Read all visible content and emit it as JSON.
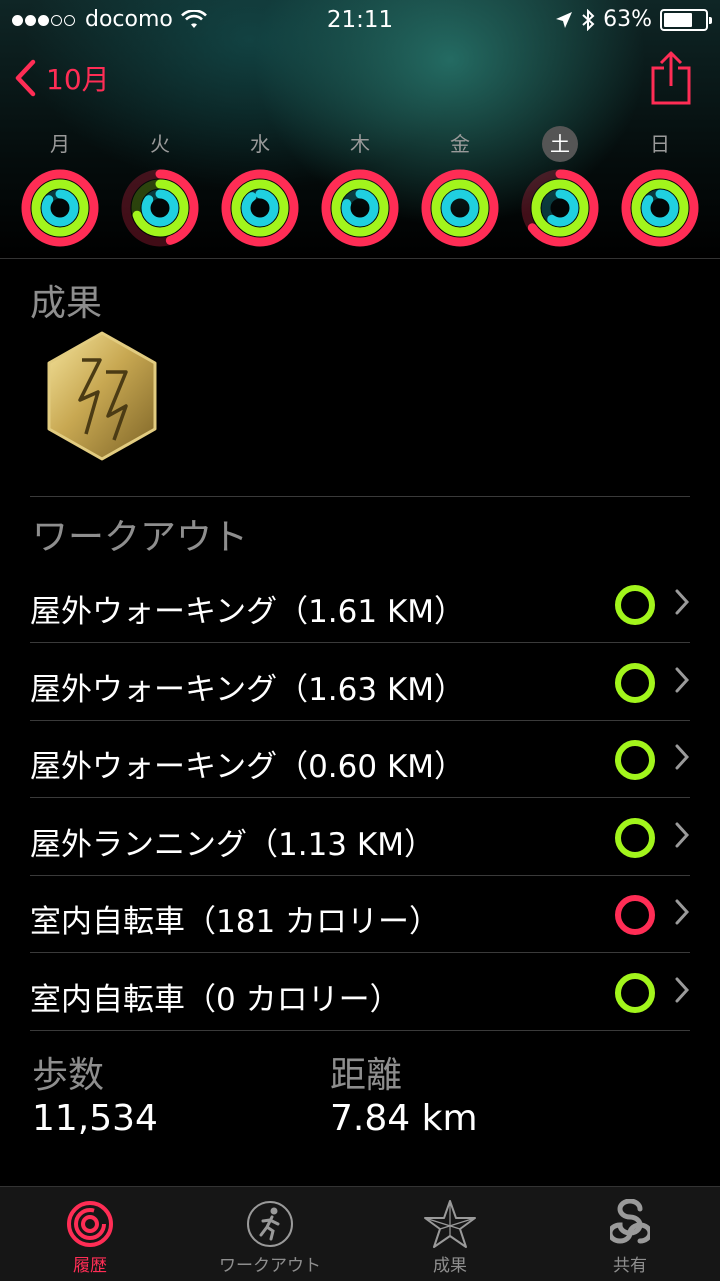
{
  "status": {
    "carrier": "docomo",
    "time": "21:11",
    "battery": "63%",
    "signal_bars_filled": 3,
    "signal_bars_total": 5
  },
  "nav": {
    "back_label": "10月"
  },
  "week": [
    {
      "label": "月",
      "selected": false,
      "move": 1.0,
      "exercise": 1.0,
      "stand": 0.85
    },
    {
      "label": "火",
      "selected": false,
      "move": 0.45,
      "exercise": 0.7,
      "stand": 0.85
    },
    {
      "label": "水",
      "selected": false,
      "move": 1.0,
      "exercise": 1.0,
      "stand": 0.9
    },
    {
      "label": "木",
      "selected": false,
      "move": 1.0,
      "exercise": 1.0,
      "stand": 0.8
    },
    {
      "label": "金",
      "selected": false,
      "move": 1.0,
      "exercise": 1.0,
      "stand": 1.0
    },
    {
      "label": "土",
      "selected": true,
      "move": 0.65,
      "exercise": 1.0,
      "stand": 0.6
    },
    {
      "label": "日",
      "selected": false,
      "move": 1.0,
      "exercise": 1.0,
      "stand": 0.85
    }
  ],
  "achievements": {
    "title": "成果"
  },
  "workouts": {
    "title": "ワークアウト",
    "items": [
      {
        "name": "屋外ウォーキング（1.61 KM）",
        "ring_color": "#a2f51c"
      },
      {
        "name": "屋外ウォーキング（1.63 KM）",
        "ring_color": "#a2f51c"
      },
      {
        "name": "屋外ウォーキング（0.60 KM）",
        "ring_color": "#a2f51c"
      },
      {
        "name": "屋外ランニング（1.13 KM）",
        "ring_color": "#a2f51c"
      },
      {
        "name": "室内自転車（181 カロリー）",
        "ring_color": "#ff2d55"
      },
      {
        "name": "室内自転車（0 カロリー）",
        "ring_color": "#a2f51c"
      }
    ]
  },
  "stats": {
    "steps_label": "歩数",
    "steps_value": "11,534",
    "distance_label": "距離",
    "distance_value": "7.84 km"
  },
  "tabs": [
    {
      "label": "履歴",
      "icon": "activity-rings-icon",
      "active": true
    },
    {
      "label": "ワークアウト",
      "icon": "running-figure-icon",
      "active": false
    },
    {
      "label": "成果",
      "icon": "star-icon",
      "active": false
    },
    {
      "label": "共有",
      "icon": "sharing-icon",
      "active": false
    }
  ],
  "colors": {
    "accent": "#ff2d55",
    "move": "#ff2d55",
    "exercise": "#a2f51c",
    "stand": "#20d0e0"
  }
}
